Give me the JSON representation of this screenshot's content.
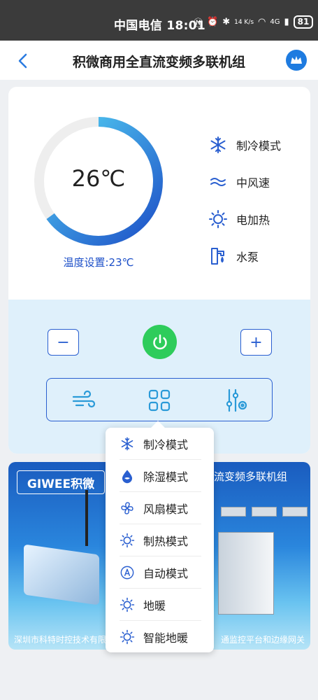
{
  "status_bar": {
    "carrier_time": "中国电信 18:01",
    "net_speed": "14 K/s",
    "signal": "4G",
    "battery": "81"
  },
  "header": {
    "title": "积微商用全直流变频多联机组"
  },
  "thermostat": {
    "current_temp": "26℃",
    "setting_label": "温度设置:23℃",
    "dial_fill_fraction": 0.65,
    "colors": {
      "track": "#eeeeee",
      "arc_start": "#1d4fc7",
      "arc_end": "#56d6f5"
    }
  },
  "status": [
    {
      "icon": "snowflake-icon",
      "label": "制冷模式"
    },
    {
      "icon": "wind-icon",
      "label": "中风速"
    },
    {
      "icon": "sun-icon",
      "label": "电加热"
    },
    {
      "icon": "pump-icon",
      "label": "水泵"
    }
  ],
  "controls": {
    "minus_label": "−",
    "plus_label": "+",
    "power_color": "#2ecc5b"
  },
  "menu": {
    "items": [
      {
        "icon": "snowflake-icon",
        "label": "制冷模式"
      },
      {
        "icon": "droplet-icon",
        "label": "除湿模式"
      },
      {
        "icon": "fan-icon",
        "label": "风扇模式"
      },
      {
        "icon": "sun-icon",
        "label": "制热模式"
      },
      {
        "icon": "auto-icon",
        "label": "自动模式"
      },
      {
        "icon": "sun-icon",
        "label": "地暖"
      },
      {
        "icon": "sun-icon",
        "label": "智能地暖"
      }
    ]
  },
  "banner": {
    "logo_text": "GIWEE积微",
    "title": "流变频多联机组",
    "footer_left": "深圳市科特时控技术有限",
    "footer_right": "通监控平台和边缘网关"
  }
}
